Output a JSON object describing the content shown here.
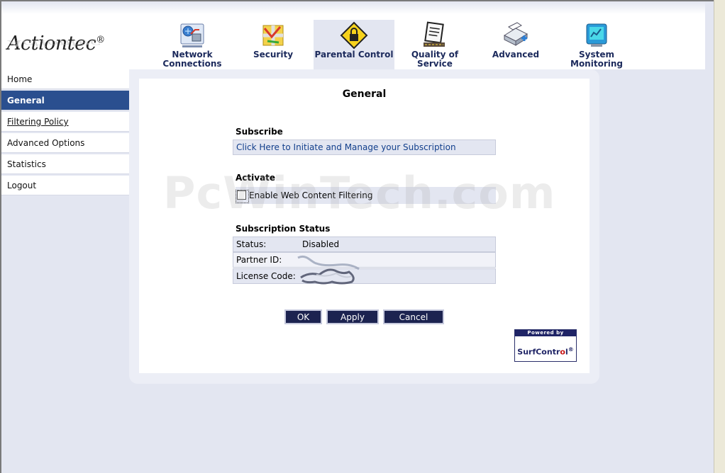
{
  "brand": {
    "logo_text": "Actiontec",
    "logo_reg": "®"
  },
  "nav": [
    {
      "label": "Network Connections",
      "icon": "network-connections-icon",
      "active": false
    },
    {
      "label": "Security",
      "icon": "security-icon",
      "active": false
    },
    {
      "label": "Parental Control",
      "icon": "parental-control-icon",
      "active": true
    },
    {
      "label": "Quality of Service",
      "icon": "quality-of-service-icon",
      "active": false
    },
    {
      "label": "Advanced",
      "icon": "advanced-icon",
      "active": false
    },
    {
      "label": "System Monitoring",
      "icon": "system-monitoring-icon",
      "active": false
    }
  ],
  "sidebar": {
    "items": [
      {
        "label": "Home"
      },
      {
        "label": "General"
      },
      {
        "label": "Filtering Policy"
      },
      {
        "label": "Advanced Options"
      },
      {
        "label": "Statistics"
      },
      {
        "label": "Logout"
      }
    ]
  },
  "main": {
    "title": "General",
    "subscribe": {
      "heading": "Subscribe",
      "link": "Click Here to Initiate and Manage your Subscription"
    },
    "activate": {
      "heading": "Activate",
      "checkbox_label": "Enable Web Content Filtering",
      "checked": false
    },
    "subscription_status": {
      "heading": "Subscription Status",
      "status_label": "Status:",
      "status_value": "Disabled",
      "partner_label": "Partner ID:",
      "license_label": "License Code:"
    },
    "buttons": {
      "ok": "OK",
      "apply": "Apply",
      "cancel": "Cancel"
    },
    "surfcontrol": {
      "powered_by": "Powered by",
      "name_a": "SurfContr",
      "name_b": "o",
      "name_c": "l",
      "reg": "®"
    }
  },
  "watermark": "PcWinTech.com",
  "colors": {
    "accent": "#2a4f8f",
    "button": "#1c2350",
    "nav_label": "#1c2a5c",
    "link": "#123f8c",
    "page_bg": "#e3e6f1"
  }
}
